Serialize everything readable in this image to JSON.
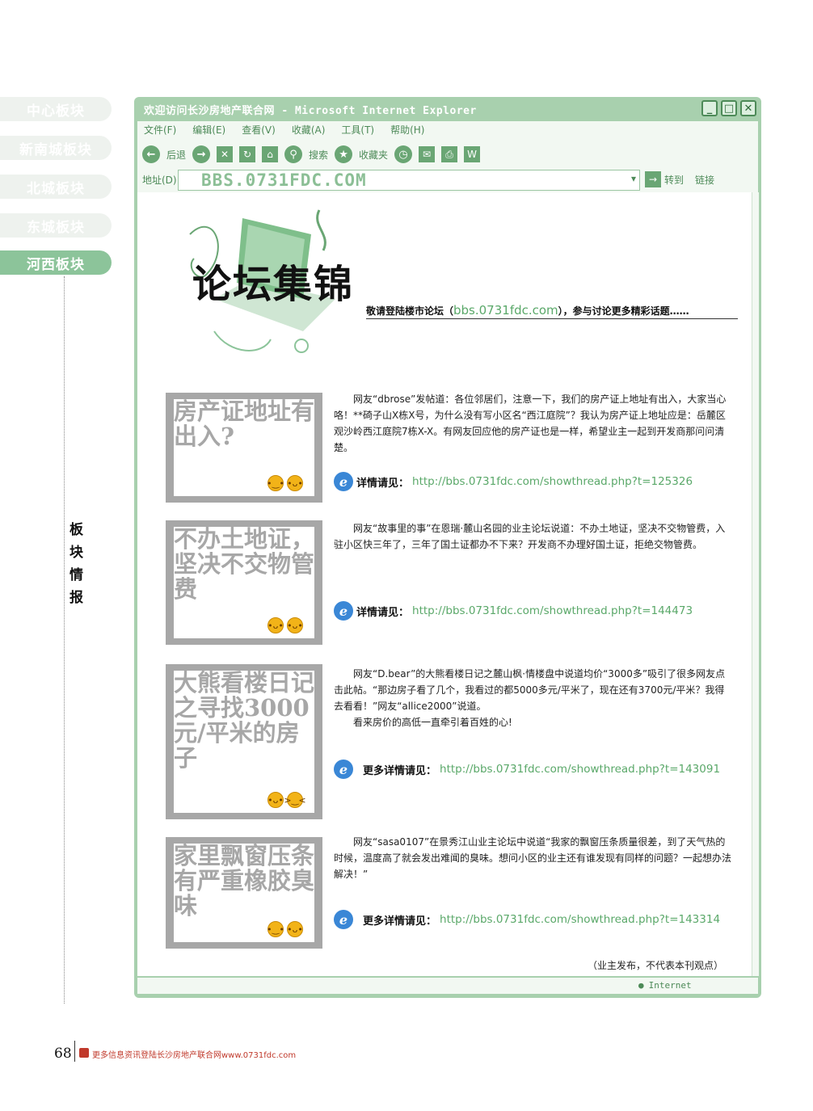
{
  "sidebar": {
    "tabs": [
      {
        "label": "中心板块",
        "active": false
      },
      {
        "label": "新南城板块",
        "active": false
      },
      {
        "label": "北城板块",
        "active": false
      },
      {
        "label": "东城板块",
        "active": false
      },
      {
        "label": "河西板块",
        "active": true
      }
    ],
    "vertical_label": [
      "板",
      "块",
      "情",
      "报"
    ]
  },
  "browser": {
    "title": "欢迎访问长沙房地产联合网 - Microsoft Internet Explorer",
    "menu": [
      "文件(F)",
      "编辑(E)",
      "查看(V)",
      "收藏(A)",
      "工具(T)",
      "帮助(H)"
    ],
    "toolbar": {
      "back": "后退",
      "search": "搜索",
      "favorites": "收藏夹"
    },
    "address_label": "地址(D)",
    "address_value": "BBS.0731FDC.COM",
    "go_label": "转到",
    "links_label": "链接",
    "status_zone": "Internet"
  },
  "header": {
    "title": "论坛集锦",
    "invite_prefix": "敬请登陆楼市论坛（",
    "invite_url": "bbs.0731fdc.com",
    "invite_suffix": "），参与讨论更多精彩话题……"
  },
  "posts": [
    {
      "title": "房产证地址有出入?",
      "body": "网友“dbrose”发帖道：各位邻居们，注意一下，我们的房产证上地址有出入，大家当心咯！**碕子山X栋X号，为什么没有写小区名“西江庭院”？我认为房产证上地址应是：岳麓区观沙岭西江庭院7栋X-X。有网友回应他的房产证也是一样，希望业主一起到开发商那问问清楚。",
      "extra": "",
      "detail_label": "详情请见：",
      "detail_url": "http://bbs.0731fdc.com/showthread.php?t=125326"
    },
    {
      "title": "不办土地证，坚决不交物管费",
      "body": "网友“故事里的事”在恩瑞·麓山名园的业主论坛说道：不办土地证，坚决不交物管费，入驻小区快三年了，三年了国土证都办不下来？开发商不办理好国土证，拒绝交物管费。",
      "extra": "",
      "detail_label": "详情请见：",
      "detail_url": "http://bbs.0731fdc.com/showthread.php?t=144473"
    },
    {
      "title": "大熊看楼日记之寻找3000元/平米的房子",
      "body": "网友“D.bear”的大熊看楼日记之麓山枫·情楼盘中说道均价“3000多”吸引了很多网友点击此帖。“那边房子看了几个，我看过的都5000多元/平米了，现在还有3700元/平米？我得去看看！”网友“allice2000”说道。",
      "extra": "看来房价的高低一直牵引着百姓的心!",
      "detail_label": "更多详情请见：",
      "detail_url": "http://bbs.0731fdc.com/showthread.php?t=143091"
    },
    {
      "title": "家里飘窗压条有严重橡胶臭味",
      "body": "网友“sasa0107”在景秀江山业主论坛中说道“我家的飘窗压条质量很差，到了天气热的时候，温度高了就会发出难闻的臭味。想问小区的业主还有谁发现有同样的问题？一起想办法解决！”",
      "extra": "",
      "detail_label": "更多详情请见：",
      "detail_url": "http://bbs.0731fdc.com/showthread.php?t=143314"
    }
  ],
  "disclaimer": "（业主发布，不代表本刊观点）",
  "footer": {
    "page_number": "68",
    "text": "更多信息资讯登陆长沙房地产联合网www.0731fdc.com"
  },
  "colors": {
    "accent": "#a8d0ae",
    "link": "#5aa869",
    "card_gray": "#a7a7a7"
  }
}
